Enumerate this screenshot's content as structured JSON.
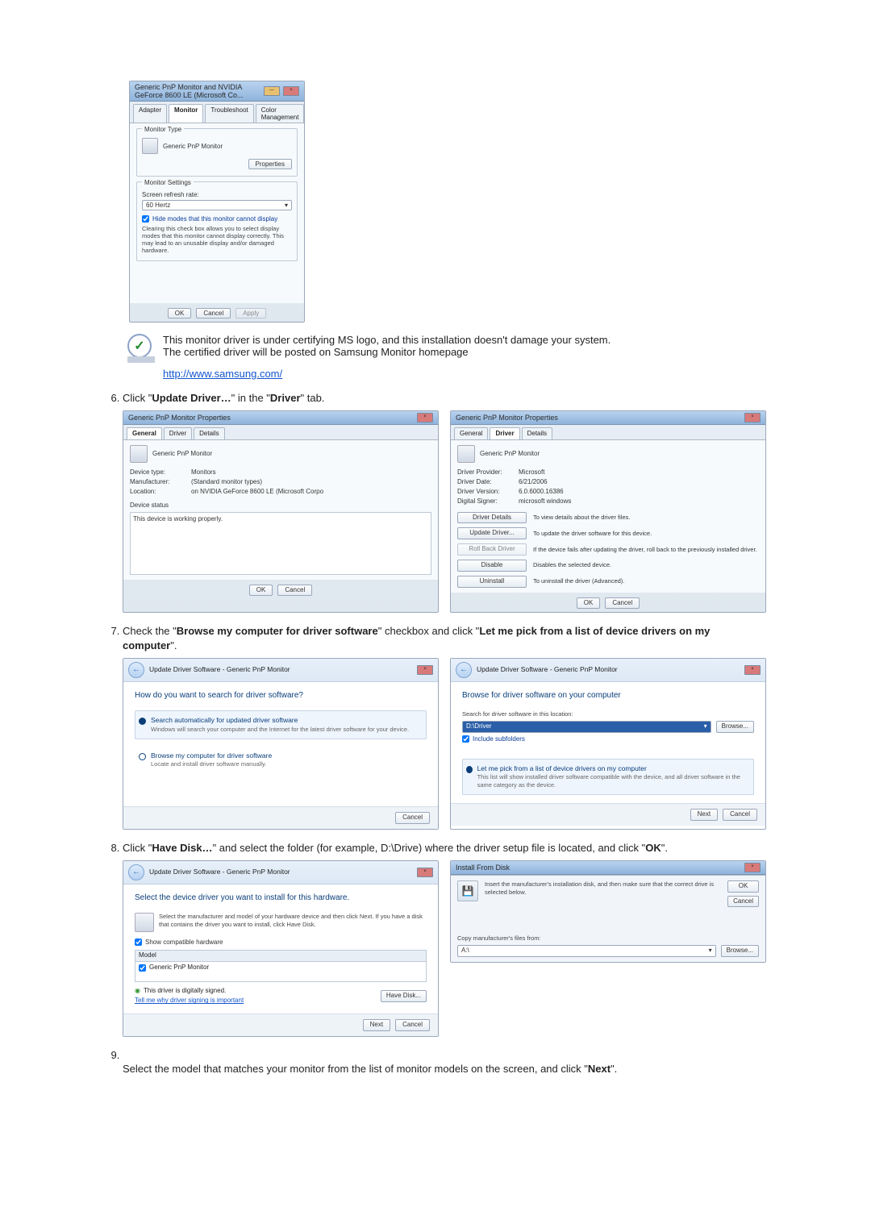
{
  "shot1": {
    "title": "Generic PnP Monitor and NVIDIA GeForce 8600 LE (Microsoft Co...",
    "tabs": [
      "Adapter",
      "Monitor",
      "Troubleshoot",
      "Color Management"
    ],
    "active_tab": "Monitor",
    "group1": "Monitor Type",
    "monitor_name": "Generic PnP Monitor",
    "btn_props": "Properties",
    "group2": "Monitor Settings",
    "refresh_label": "Screen refresh rate:",
    "refresh_value": "60 Hertz",
    "hide_modes": "Hide modes that this monitor cannot display",
    "hide_desc": "Clearing this check box allows you to select display modes that this monitor cannot display correctly. This may lead to an unusable display and/or damaged hardware.",
    "ok": "OK",
    "cancel": "Cancel",
    "apply": "Apply"
  },
  "note": {
    "line1": "This monitor driver is under certifying MS logo, and this installation doesn't damage your system.",
    "line2": "The certified driver will be posted on Samsung Monitor homepage",
    "url": "http://www.samsung.com/"
  },
  "step6": {
    "text_a": "Click \"",
    "bold_a": "Update Driver…",
    "text_b": "\" in the \"",
    "bold_b": "Driver",
    "text_c": "\" tab."
  },
  "shot6a": {
    "title": "Generic PnP Monitor Properties",
    "tabs": [
      "General",
      "Driver",
      "Details"
    ],
    "active": "General",
    "dev_name": "Generic PnP Monitor",
    "f1l": "Device type:",
    "f1v": "Monitors",
    "f2l": "Manufacturer:",
    "f2v": "(Standard monitor types)",
    "f3l": "Location:",
    "f3v": "on NVIDIA GeForce 8600 LE (Microsoft Corpo",
    "status_label": "Device status",
    "status_text": "This device is working properly.",
    "ok": "OK",
    "cancel": "Cancel"
  },
  "shot6b": {
    "title": "Generic PnP Monitor Properties",
    "tabs": [
      "General",
      "Driver",
      "Details"
    ],
    "active": "Driver",
    "dev_name": "Generic PnP Monitor",
    "p1l": "Driver Provider:",
    "p1v": "Microsoft",
    "p2l": "Driver Date:",
    "p2v": "6/21/2006",
    "p3l": "Driver Version:",
    "p3v": "6.0.6000.16386",
    "p4l": "Digital Signer:",
    "p4v": "microsoft windows",
    "b1": "Driver Details",
    "b1d": "To view details about the driver files.",
    "b2": "Update Driver...",
    "b2d": "To update the driver software for this device.",
    "b3": "Roll Back Driver",
    "b3d": "If the device fails after updating the driver, roll back to the previously installed driver.",
    "b4": "Disable",
    "b4d": "Disables the selected device.",
    "b5": "Uninstall",
    "b5d": "To uninstall the driver (Advanced).",
    "ok": "OK",
    "cancel": "Cancel"
  },
  "step7": {
    "a": "Check the \"",
    "b": "Browse my computer for driver software",
    "c": "\" checkbox and click \"",
    "d": "Let me pick from a list of device drivers on my computer",
    "e": "\"."
  },
  "shot7a": {
    "crumb": "Update Driver Software - Generic PnP Monitor",
    "q": "How do you want to search for driver software?",
    "o1": "Search automatically for updated driver software",
    "o1s": "Windows will search your computer and the Internet for the latest driver software for your device.",
    "o2": "Browse my computer for driver software",
    "o2s": "Locate and install driver software manually.",
    "cancel": "Cancel"
  },
  "shot7b": {
    "crumb": "Update Driver Software - Generic PnP Monitor",
    "q": "Browse for driver software on your computer",
    "sl": "Search for driver software in this location:",
    "path": "D:\\Driver",
    "browse": "Browse...",
    "inc": "Include subfolders",
    "o1": "Let me pick from a list of device drivers on my computer",
    "o1s": "This list will show installed driver software compatible with the device, and all driver software in the same category as the device.",
    "next": "Next",
    "cancel": "Cancel"
  },
  "step8": {
    "a": "Click \"",
    "b": "Have Disk…",
    "c": "\" and select the folder (for example, D:\\Drive) where the driver setup file is located, and click \"",
    "d": "OK",
    "e": "\"."
  },
  "shot8a": {
    "crumb": "Update Driver Software - Generic PnP Monitor",
    "q": "Select the device driver you want to install for this hardware.",
    "sub": "Select the manufacturer and model of your hardware device and then click Next. If you have a disk that contains the driver you want to install, click Have Disk.",
    "compat": "Show compatible hardware",
    "mh": "Model",
    "model": "Generic PnP Monitor",
    "signed": "This driver is digitally signed.",
    "why": "Tell me why driver signing is important",
    "have": "Have Disk...",
    "next": "Next",
    "cancel": "Cancel"
  },
  "shot8b": {
    "title": "Install From Disk",
    "msg": "Insert the manufacturer's installation disk, and then make sure that the correct drive is selected below.",
    "ok": "OK",
    "cancel": "Cancel",
    "copy": "Copy manufacturer's files from:",
    "path": "A:\\",
    "browse": "Browse..."
  },
  "step9": {
    "a": "Select the model that matches your monitor from the list of monitor models on the screen, and click \"",
    "b": "Next",
    "c": "\"."
  }
}
